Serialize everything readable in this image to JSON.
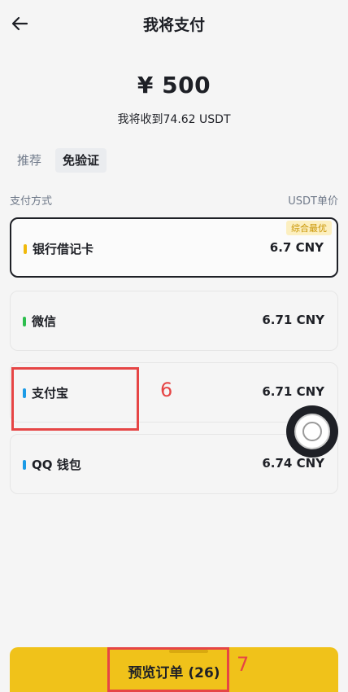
{
  "header": {
    "title": "我将支付",
    "back_icon": "arrow-left-icon"
  },
  "order": {
    "amount": "¥ 500",
    "receive_text": "我将收到74.62 USDT"
  },
  "tabs": [
    {
      "label": "推荐",
      "active": false
    },
    {
      "label": "免验证",
      "active": true
    }
  ],
  "columns": {
    "left": "支付方式",
    "right": "USDT单价"
  },
  "methods": [
    {
      "name": "银行借记卡",
      "price": "6.7 CNY",
      "badge": "综合最优",
      "color": "#f0b90b",
      "selected": true
    },
    {
      "name": "微信",
      "price": "6.71 CNY",
      "color": "#2dbe4e",
      "selected": false
    },
    {
      "name": "支付宝",
      "price": "6.71 CNY",
      "color": "#1c9be6",
      "selected": false
    },
    {
      "name": "QQ 钱包",
      "price": "6.74 CNY",
      "color": "#1c9be6",
      "selected": false
    }
  ],
  "annotations": {
    "six": "6",
    "seven": "7"
  },
  "cta": {
    "label": "预览订单 (26)"
  },
  "colors": {
    "accent": "#f0c21a",
    "annotation": "#e64545",
    "text_primary": "#1e2026",
    "text_secondary": "#707a8a"
  }
}
